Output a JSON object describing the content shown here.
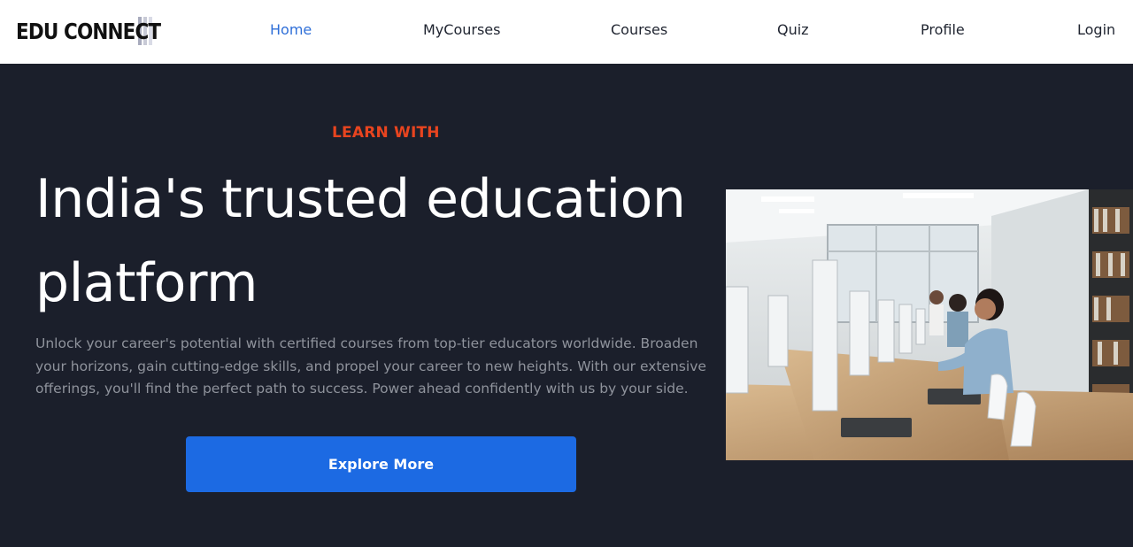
{
  "brand": {
    "name": "EDU CONNECT"
  },
  "nav": {
    "items": [
      {
        "label": "Home",
        "active": true
      },
      {
        "label": "MyCourses",
        "active": false
      },
      {
        "label": "Courses",
        "active": false
      },
      {
        "label": "Quiz",
        "active": false
      },
      {
        "label": "Profile",
        "active": false
      },
      {
        "label": "Login",
        "active": false
      }
    ]
  },
  "hero": {
    "eyebrow": "LEARN WITH",
    "title": "India's trusted education platform",
    "description": "Unlock your career's potential with certified courses from top-tier educators worldwide. Broaden your horizons, gain cutting-edge skills, and propel your career to new heights. With our extensive offerings, you'll find the perfect path to success. Power ahead confidently with us by your side.",
    "cta_label": "Explore More",
    "image_subject": "students-in-computer-lab-photo"
  },
  "colors": {
    "background": "#1b1f2b",
    "accent": "#e8441f",
    "primary": "#1c6ae3",
    "nav_active": "#2f6fd8"
  }
}
